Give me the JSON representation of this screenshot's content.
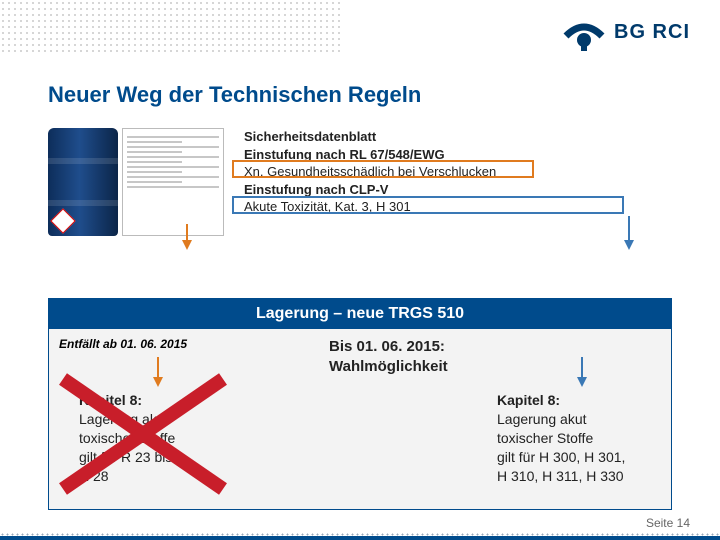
{
  "logo": {
    "text": "BG RCI"
  },
  "title": "Neuer Weg der Technischen Regeln",
  "sds": {
    "heading": "Sicherheitsdatenblatt",
    "line1": "Einstufung nach RL 67/548/EWG",
    "line2": "Xn, Gesundheitsschädlich bei Verschlucken",
    "line3": "Einstufung nach CLP-V",
    "line4": "Akute Toxizität, Kat. 3, H 301"
  },
  "trgs": {
    "header": "Lagerung – neue TRGS 510",
    "entfaellt": "Entfällt ab 01. 06. 2015",
    "bis_line1": "Bis 01. 06. 2015:",
    "bis_line2": "Wahlmöglichkeit",
    "left": {
      "head": "Kapitel 8:",
      "l1": "Lagerung akut",
      "l2": "toxischer Stoffe",
      "l3": "gilt für R 23 bis",
      "l4": "R 28"
    },
    "right": {
      "head": "Kapitel 8:",
      "l1": "Lagerung akut",
      "l2": "toxischer Stoffe",
      "l3": "gilt für H 300, H 301,",
      "l4": "H 310, H 311, H 330"
    }
  },
  "footer": {
    "page_label": "Seite",
    "page_num": "14"
  },
  "colors": {
    "brand": "#004b8c",
    "orange": "#e07b1f",
    "blue2": "#3a78b5"
  }
}
